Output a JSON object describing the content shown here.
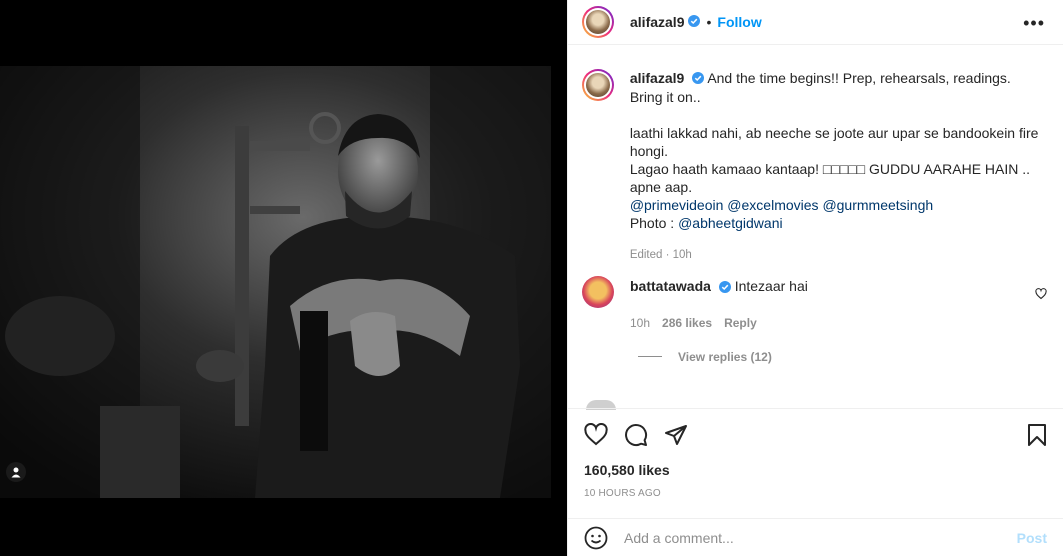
{
  "post": {
    "username": "alifazal9",
    "follow_label": "Follow",
    "dot": "•",
    "more_label": "•••",
    "caption": {
      "username": "alifazal9",
      "line1": "And the time begins!! Prep, rehearsals, readings. Bring it on..",
      "line2": "laathi lakkad nahi, ab neeche se joote aur upar se bandookein fire hongi.",
      "line3": "Lagao haath kamaao kantaap! □□□□□ GUDDU AARAHE HAIN .. apne aap.",
      "mentions": [
        "@primevideoin",
        "@excelmovies",
        "@gurmmeetsingh"
      ],
      "photo_prefix": "Photo : ",
      "photo_mention": "@abheetgidwani",
      "meta": "Edited · 10h"
    },
    "comment": {
      "username": "battatawada",
      "text": "Intezaar hai",
      "time": "10h",
      "likes": "286 likes",
      "reply_label": "Reply",
      "view_replies": "View replies (12)"
    },
    "likes": "160,580 likes",
    "timestamp": "10 HOURS AGO",
    "add_comment_placeholder": "Add a comment...",
    "post_label": "Post"
  },
  "icons": {
    "verified": "verified-badge-icon",
    "more": "more-options-icon",
    "like": "heart-icon",
    "comment": "comment-icon",
    "share": "share-icon",
    "save": "bookmark-icon",
    "emoji": "emoji-icon",
    "tag": "user-tag-icon"
  },
  "colors": {
    "accent": "#0095f6",
    "verified": "#3897f0",
    "muted": "#8e8e8e",
    "mention": "#00376b",
    "post_disabled": "#b2dffc"
  }
}
